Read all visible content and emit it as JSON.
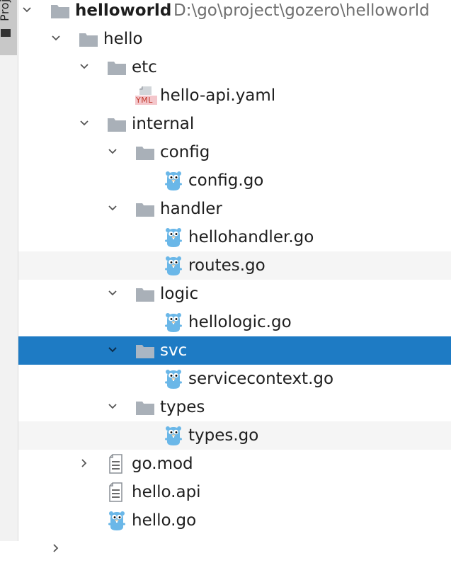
{
  "side_panel": {
    "tab_label": "Proj"
  },
  "tree": {
    "root": {
      "name": "helloworld",
      "path": "D:\\go\\project\\gozero\\helloworld"
    },
    "items": [
      {
        "label": "hello",
        "kind": "folder",
        "expanded": true
      },
      {
        "label": "etc",
        "kind": "folder",
        "expanded": true
      },
      {
        "label": "hello-api.yaml",
        "kind": "yaml"
      },
      {
        "label": "internal",
        "kind": "folder",
        "expanded": true
      },
      {
        "label": "config",
        "kind": "folder",
        "expanded": true
      },
      {
        "label": "config.go",
        "kind": "go"
      },
      {
        "label": "handler",
        "kind": "folder",
        "expanded": true
      },
      {
        "label": "hellohandler.go",
        "kind": "go"
      },
      {
        "label": "routes.go",
        "kind": "go"
      },
      {
        "label": "logic",
        "kind": "folder",
        "expanded": true
      },
      {
        "label": "hellologic.go",
        "kind": "go"
      },
      {
        "label": "svc",
        "kind": "folder",
        "expanded": true,
        "selected": true
      },
      {
        "label": "servicecontext.go",
        "kind": "go"
      },
      {
        "label": "types",
        "kind": "folder",
        "expanded": true
      },
      {
        "label": "types.go",
        "kind": "go"
      },
      {
        "label": "go.mod",
        "kind": "text",
        "expanded": false
      },
      {
        "label": "hello.api",
        "kind": "text"
      },
      {
        "label": "hello.go",
        "kind": "go"
      }
    ]
  },
  "icons": {
    "yaml_badge": "YML",
    "chevron_expanded": "chevron-down-icon",
    "chevron_collapsed": "chevron-right-icon",
    "folder": "folder-icon",
    "gopher": "gopher-icon",
    "text_file": "text-file-icon"
  },
  "colors": {
    "selection": "#1e7bc4",
    "hover": "#f5f5f5",
    "folder": "#a9b0b8",
    "gopher": "#6ab7e8",
    "yaml_badge": "#e06c75"
  }
}
